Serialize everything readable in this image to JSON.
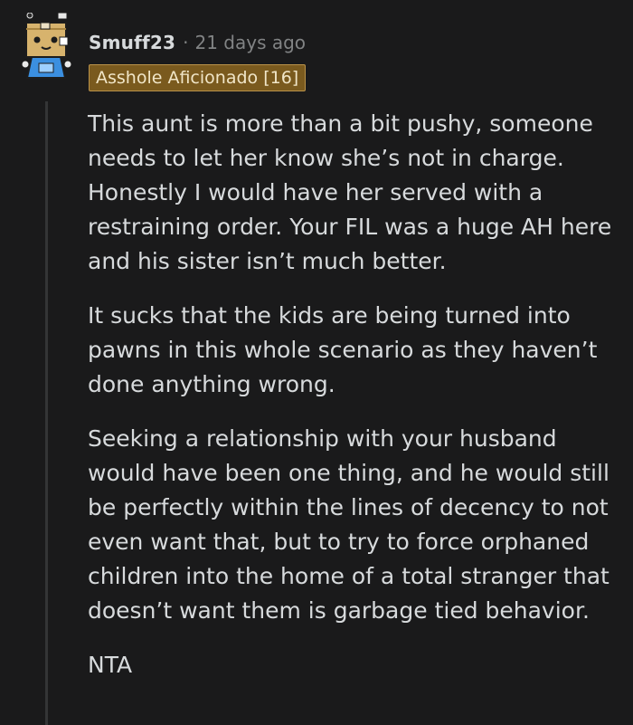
{
  "comment": {
    "username": "Smuff23",
    "separator": "·",
    "timestamp": "21 days ago",
    "flair": "Asshole Aficionado [16]",
    "avatar_icon": "robot-box-avatar-icon",
    "paragraphs": [
      "This aunt is more than a bit pushy, someone needs to let her know she’s not in charge. Honestly I would have her served with a restraining order. Your FIL was a huge AH here and his sister isn’t much better.",
      "It sucks that the kids are being turned into pawns in this whole scenario as they haven’t done anything wrong.",
      "Seeking a relationship with your husband would have been one thing, and he would still be perfectly within the lines of decency to not even want that, but to try to force orphaned children into the home of a total stranger that doesn’t want them is garbage tied behavior.",
      "NTA"
    ]
  },
  "colors": {
    "background": "#1a1a1b",
    "text": "#d7dadc",
    "meta": "#818384",
    "flair_bg": "#7a5a1e",
    "flair_border": "#b9924a",
    "thread_line": "#343536"
  }
}
